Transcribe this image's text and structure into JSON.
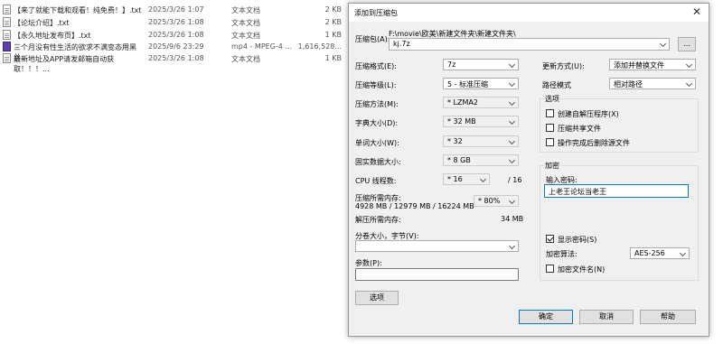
{
  "files": [
    {
      "name": "【来了就能下载和观看！纯免费！】.txt",
      "date": "2025/3/26 1:07",
      "type": "文本文档",
      "size": "2 KB",
      "icon": "text-file-icon"
    },
    {
      "name": "【论坛介绍】.txt",
      "date": "2025/3/26 1:08",
      "type": "文本文档",
      "size": "2 KB",
      "icon": "text-file-icon"
    },
    {
      "name": "【永久地址发布页】.txt",
      "date": "2025/3/26 1:08",
      "type": "文本文档",
      "size": "1 KB",
      "icon": "text-file-icon"
    },
    {
      "name": "三个月没有性生活的欲求不满变态用黑丝...",
      "date": "2025/9/6 23:29",
      "type": "mp4 - MPEG-4 ...",
      "size": "1,616,528...",
      "icon": "video-file-icon"
    },
    {
      "name": "最新地址及APP请发邮箱自动获取！！！...",
      "date": "2025/3/26 1:08",
      "type": "文本文档",
      "size": "1 KB",
      "icon": "text-file-icon"
    }
  ],
  "dialog": {
    "title": "添加到压缩包",
    "archive_label": "压缩包(A):",
    "archive_path": "F:\\movie\\欧美\\新建文件夹\\新建文件夹\\",
    "archive_name": "kj.7z",
    "browse_label": "...",
    "format_label": "压缩格式(E):",
    "format_value": "7z",
    "level_label": "压缩等级(L):",
    "level_value": "5 - 标准压缩",
    "method_label": "压缩方法(M):",
    "method_value": "* LZMA2",
    "dict_label": "字典大小(D):",
    "dict_value": "* 32 MB",
    "word_label": "单词大小(W):",
    "word_value": "* 32",
    "solid_label": "固实数据大小:",
    "solid_value": "* 8 GB",
    "cpu_label": "CPU 线程数:",
    "cpu_value": "* 16",
    "cpu_total": "/ 16",
    "mem_comp_label": "压缩所需内存:",
    "mem_comp_value": "4928 MB / 12979 MB / 16224 MB",
    "mem_percent": "* 80%",
    "mem_decomp_label": "解压所需内存:",
    "mem_decomp_value": "34 MB",
    "split_label": "分卷大小，字节(V):",
    "split_value": "",
    "params_label": "参数(P):",
    "params_value": "",
    "options_button": "选项",
    "update_label": "更新方式(U):",
    "update_value": "添加并替换文件",
    "pathmode_label": "路径模式",
    "pathmode_value": "相对路径",
    "options_group": "选项",
    "opt_sfx": "创建自解压程序(X)",
    "opt_shared": "压缩共享文件",
    "opt_delete": "操作完成后删除源文件",
    "encrypt_group": "加密",
    "password_label": "输入密码:",
    "password_value": "上老王论坛当老王",
    "show_password": "显示密码(S)",
    "enc_method_label": "加密算法:",
    "enc_method_value": "AES-256",
    "encrypt_names": "加密文件名(N)",
    "ok_button": "确定",
    "cancel_button": "取消",
    "help_button": "帮助",
    "close_glyph": "✕"
  }
}
